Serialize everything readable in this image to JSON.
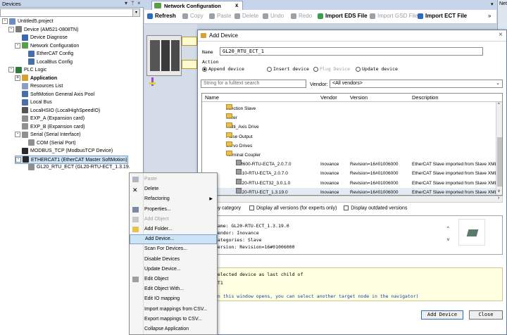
{
  "devices_panel": {
    "title": "Devices",
    "pin_glyph": "▾  ɰ  ×",
    "tree": [
      {
        "label": "Untitled5.project",
        "depth": 0,
        "expander": "-",
        "icon_color": "#6b8cc4",
        "name": "tree-item-project"
      },
      {
        "label": "Device (AM521-0808TN)",
        "depth": 1,
        "expander": "-",
        "icon_color": "#7a7a7a",
        "name": "tree-item-device"
      },
      {
        "label": "Device Diagnose",
        "depth": 2,
        "expander": "",
        "icon_color": "#3a66b8",
        "name": "tree-item-device-diagnose"
      },
      {
        "label": "Network Configuration",
        "depth": 2,
        "expander": "-",
        "icon_color": "#5aa04a",
        "name": "tree-item-network-configuration"
      },
      {
        "label": "EtherCAT Config",
        "depth": 3,
        "expander": "",
        "icon_color": "#4a6fa8",
        "name": "tree-item-ethercat-config"
      },
      {
        "label": "LocalBus Config",
        "depth": 3,
        "expander": "",
        "icon_color": "#4a6fa8",
        "name": "tree-item-localbus-config"
      },
      {
        "label": "PLC Logic",
        "depth": 1,
        "expander": "-",
        "icon_color": "#2f7a3a",
        "name": "tree-item-plc-logic"
      },
      {
        "label": "Application",
        "depth": 2,
        "expander": "+",
        "icon_color": "#d9a030",
        "name": "tree-item-application",
        "bold": true
      },
      {
        "label": "Resources List",
        "depth": 2,
        "expander": "",
        "icon_color": "#8aa0c0",
        "name": "tree-item-resources-list"
      },
      {
        "label": "SoftMotion General Axis Pool",
        "depth": 2,
        "expander": "",
        "icon_color": "#4a6fa8",
        "name": "tree-item-softmotion-axis-pool"
      },
      {
        "label": "Local Bus",
        "depth": 2,
        "expander": "",
        "icon_color": "#4a6fa8",
        "name": "tree-item-local-bus"
      },
      {
        "label": "LocalHSIO (LocalHighSpeedIO)",
        "depth": 2,
        "expander": "",
        "icon_color": "#555555",
        "name": "tree-item-localhsio"
      },
      {
        "label": "EXP_A (Expansion card)",
        "depth": 2,
        "expander": "",
        "icon_color": "#909090",
        "name": "tree-item-exp-a"
      },
      {
        "label": "EXP_B (Expansion card)",
        "depth": 2,
        "expander": "",
        "icon_color": "#909090",
        "name": "tree-item-exp-b"
      },
      {
        "label": "Serial (Serial Interface)",
        "depth": 2,
        "expander": "-",
        "icon_color": "#909090",
        "name": "tree-item-serial"
      },
      {
        "label": "COM (Serial Port)",
        "depth": 3,
        "expander": "",
        "icon_color": "#909090",
        "name": "tree-item-com"
      },
      {
        "label": "MODBUS_TCP (ModbusTCP Device)",
        "depth": 2,
        "expander": "",
        "icon_color": "#2a2a2a",
        "name": "tree-item-modbus-tcp"
      },
      {
        "label": "ETHERCAT1 (EtherCAT Master SoftMotion)",
        "depth": 2,
        "expander": "-",
        "icon_color": "#2a2a2a",
        "name": "tree-item-ethercat1",
        "selected": true
      },
      {
        "label": "GL20_RTU_ECT (GL20-RTU-ECT_1.3.19.",
        "depth": 3,
        "expander": "",
        "icon_color": "#909090",
        "name": "tree-item-gl20-rtu-ect"
      }
    ]
  },
  "tabs": {
    "active": "Network Configuration",
    "close": "x",
    "right_panel_label": "Net"
  },
  "toolbar": {
    "items": [
      {
        "label": "Refresh",
        "enabled": true,
        "name": "refresh-button",
        "icon_color": "#2a6cc4"
      },
      {
        "label": "Copy",
        "enabled": false,
        "name": "copy-button",
        "icon_color": "#9aa0a8"
      },
      {
        "label": "Paste",
        "enabled": false,
        "name": "paste-button",
        "icon_color": "#9aa0a8"
      },
      {
        "label": "Delete",
        "enabled": false,
        "name": "delete-button",
        "icon_color": "#9aa0a8"
      },
      {
        "label": "Undo",
        "enabled": false,
        "name": "undo-button",
        "icon_color": "#9aa0a8"
      },
      {
        "label": "Redo",
        "enabled": false,
        "name": "redo-button",
        "icon_color": "#9aa0a8"
      },
      {
        "label": "Import EDS File",
        "enabled": true,
        "name": "import-eds-button",
        "icon_color": "#3aa04a"
      },
      {
        "label": "Import GSD File",
        "enabled": false,
        "name": "import-gsd-button",
        "icon_color": "#9aa0a8"
      },
      {
        "label": "Import ECT File",
        "enabled": true,
        "name": "import-ect-button",
        "icon_color": "#2a6cc4"
      }
    ]
  },
  "dialog": {
    "title": "Add Device",
    "close_glyph": "×",
    "name_label": "Name",
    "name_value": "GL20_RTU_ECT_1",
    "action_label": "Action",
    "actions": [
      {
        "label": "Append device",
        "checked": true,
        "enabled": true,
        "name": "append-device-radio"
      },
      {
        "label": "Insert device",
        "checked": false,
        "enabled": true,
        "name": "insert-device-radio"
      },
      {
        "label": "Plug Device",
        "checked": false,
        "enabled": false,
        "name": "plug-device-radio"
      },
      {
        "label": "Update device",
        "checked": false,
        "enabled": true,
        "name": "update-device-radio"
      }
    ],
    "search_placeholder": "String for a fulltext search",
    "vendor_label": "Vendor:",
    "vendor_value": "<All vendors>",
    "columns": [
      "Name",
      "Vendor",
      "Version",
      "Description"
    ],
    "rows": [
      {
        "name": "Junction Slave",
        "type": "folder",
        "indent": 2,
        "vendor": "",
        "version": "",
        "desc": ""
      },
      {
        "name": "Mixer",
        "type": "folder",
        "indent": 2,
        "vendor": "",
        "version": "",
        "desc": ""
      },
      {
        "name": "Multi_Axis Drive",
        "type": "folder",
        "indent": 2,
        "vendor": "",
        "version": "",
        "desc": ""
      },
      {
        "name": "Pulse Output",
        "type": "folder",
        "indent": 2,
        "vendor": "",
        "version": "",
        "desc": ""
      },
      {
        "name": "Servo Drives",
        "type": "folder",
        "indent": 2,
        "vendor": "",
        "version": "",
        "desc": ""
      },
      {
        "name": "Terminal Coupler",
        "type": "folder-open",
        "indent": 2,
        "vendor": "",
        "version": "",
        "desc": ""
      },
      {
        "name": "AM600-RTU-ECTA_2.0.7.0",
        "type": "device",
        "indent": 3,
        "vendor": "Inovance",
        "version": "Revision=16#01006000",
        "desc": "EtherCAT Slave imported from Slave XML"
      },
      {
        "name": "GL10-RTU-ECTA_2.0.7.0",
        "type": "device",
        "indent": 3,
        "vendor": "Inovance",
        "version": "Revision=16#01006000",
        "desc": "EtherCAT Slave imported from Slave XML"
      },
      {
        "name": "GL20-RTU-ECT32_3.0.1.0",
        "type": "device",
        "indent": 3,
        "vendor": "Inovance",
        "version": "Revision=16#01006000",
        "desc": "EtherCAT Slave imported from Slave XML"
      },
      {
        "name": "GL20-RTU-ECT_1.3.19.0",
        "type": "device",
        "indent": 3,
        "vendor": "Inovance",
        "version": "Revision=16#01006000",
        "desc": "EtherCAT Slave imported from Slave XML",
        "selected": true
      }
    ],
    "filters": [
      {
        "label": "Group by category",
        "visible_label": "p by category",
        "name": "group-by-category-checkbox"
      },
      {
        "label": "Display all versions (for experts only)",
        "name": "display-all-versions-checkbox"
      },
      {
        "label": "Display outdated versions",
        "name": "display-outdated-versions-checkbox"
      }
    ],
    "info": {
      "name_line": "Name: GL20-RTU-ECT_1.3.19.0",
      "vendor_line": "Vendor: Inovance",
      "categories_line": "Categories: Slave",
      "version_line": "Version: Revision=16#01006000"
    },
    "hint": {
      "line1": "selected device as last child of",
      "line2": "AT1",
      "line3": "an this window opens, you can select another target node in the navigator)"
    },
    "buttons": {
      "add": "Add Device",
      "close": "Close"
    }
  },
  "context_menu": {
    "items": [
      {
        "label": "Paste",
        "enabled": false,
        "icon": "paste-icon",
        "name": "menu-paste"
      },
      {
        "label": "Delete",
        "enabled": true,
        "icon": "delete-icon",
        "name": "menu-delete"
      },
      {
        "label": "Refactoring",
        "enabled": true,
        "icon": "",
        "name": "menu-refactoring",
        "submenu": true
      },
      {
        "label": "Properties...",
        "enabled": true,
        "icon": "properties-icon",
        "name": "menu-properties"
      },
      {
        "label": "Add Object",
        "enabled": false,
        "icon": "add-object-icon",
        "name": "menu-add-object"
      },
      {
        "label": "Add Folder...",
        "enabled": true,
        "icon": "folder-icon",
        "name": "menu-add-folder"
      },
      {
        "label": "Add Device...",
        "enabled": true,
        "icon": "",
        "name": "menu-add-device",
        "highlighted": true
      },
      {
        "label": "Scan For Devices...",
        "enabled": true,
        "icon": "",
        "name": "menu-scan-devices"
      },
      {
        "label": "Disable Devices",
        "enabled": true,
        "icon": "",
        "name": "menu-disable-devices"
      },
      {
        "label": "Update Device...",
        "enabled": true,
        "icon": "",
        "name": "menu-update-device"
      },
      {
        "label": "Edit Object",
        "enabled": true,
        "icon": "edit-icon",
        "name": "menu-edit-object"
      },
      {
        "label": "Edit Object With...",
        "enabled": true,
        "icon": "",
        "name": "menu-edit-object-with"
      },
      {
        "label": "Edit IO mapping",
        "enabled": true,
        "icon": "",
        "name": "menu-edit-io-mapping"
      },
      {
        "label": "Import mappings from CSV...",
        "enabled": true,
        "icon": "",
        "name": "menu-import-mappings"
      },
      {
        "label": "Export mappings to CSV...",
        "enabled": true,
        "icon": "",
        "name": "menu-export-mappings"
      },
      {
        "label": "Collapse Application",
        "enabled": true,
        "icon": "",
        "name": "menu-collapse-application"
      }
    ]
  }
}
